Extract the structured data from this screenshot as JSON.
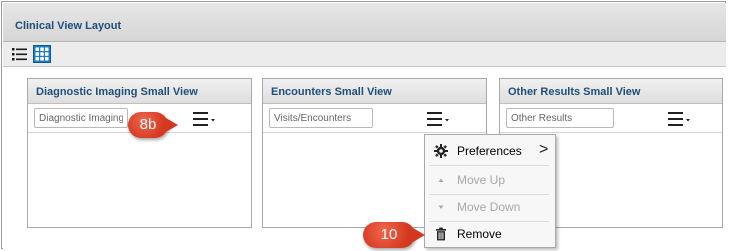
{
  "window": {
    "title": "Clinical View Layout"
  },
  "toolbar": {
    "buttons": [
      {
        "icon": "list-view-icon"
      },
      {
        "icon": "grid-view-icon",
        "active": true
      }
    ]
  },
  "panels": [
    {
      "title": "Diagnostic Imaging Small View",
      "input_value": "Diagnostic Imaging"
    },
    {
      "title": "Encounters Small View",
      "input_value": "Visits/Encounters"
    },
    {
      "title": "Other Results Small View",
      "input_value": "Other Results"
    }
  ],
  "menu": {
    "items": [
      {
        "label": "Preferences",
        "icon": "gear-icon",
        "submenu_arrow": ">"
      },
      {
        "label": "Move Up",
        "icon": "arrow-up-icon",
        "disabled": true
      },
      {
        "label": "Move Down",
        "icon": "arrow-down-icon",
        "disabled": true
      },
      {
        "label": "Remove",
        "icon": "trash-icon"
      }
    ]
  },
  "callouts": [
    {
      "label": "8b",
      "color": "#d4371f"
    },
    {
      "label": "10",
      "color": "#d4371f"
    }
  ],
  "colors": {
    "title_text": "#1f4e79",
    "grid_button_active": "#1a7fc1",
    "callout": "#d4371f"
  }
}
